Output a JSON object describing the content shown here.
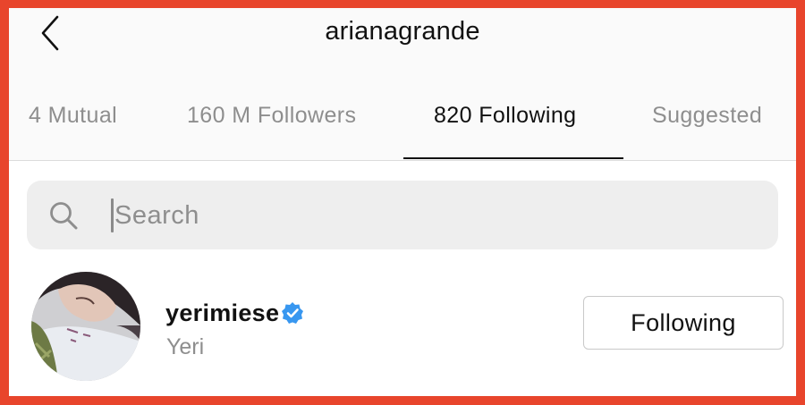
{
  "header": {
    "title": "arianagrande",
    "back_icon": "chevron-left-icon"
  },
  "tabs": [
    {
      "label": "4 Mutual",
      "active": false
    },
    {
      "label": "160 M Followers",
      "active": false
    },
    {
      "label": "820 Following",
      "active": true
    },
    {
      "label": "Suggested",
      "active": false
    }
  ],
  "search": {
    "placeholder": "Search",
    "value": "",
    "icon": "search-icon"
  },
  "users": [
    {
      "username": "yerimiese",
      "full_name": "Yeri",
      "verified": true,
      "button_label": "Following"
    }
  ],
  "colors": {
    "frame_border": "#e8452c",
    "verified_badge": "#3897f0",
    "secondary_text": "#8e8e8e"
  }
}
